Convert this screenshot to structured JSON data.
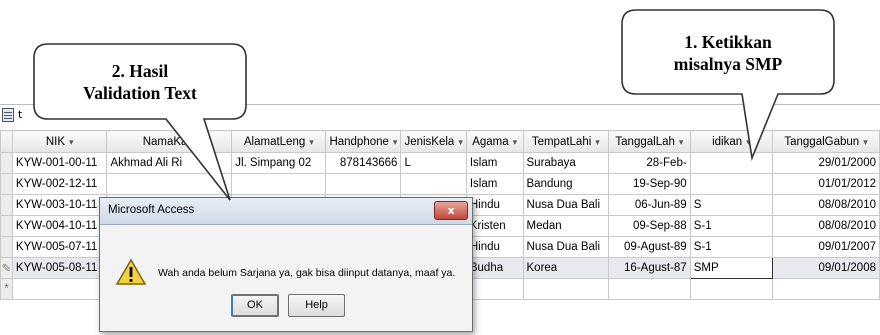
{
  "tab": {
    "label": "t"
  },
  "columns": [
    "NIK",
    "NamaKa",
    "AlamatLeng",
    "Handphone",
    "JenisKela",
    "Agama",
    "TempatLahi",
    "TanggalLah",
    "idikan",
    "TanggalGabun"
  ],
  "rows": [
    {
      "sel": "",
      "cells": [
        "KYW-001-00-11",
        "Akhmad Ali Ri",
        "Jl. Simpang 02",
        "878143666",
        "L",
        "Islam",
        "Surabaya",
        "28-Feb-",
        "",
        "29/01/2000"
      ]
    },
    {
      "sel": "",
      "cells": [
        "KYW-002-12-11",
        "",
        "",
        "",
        "",
        "Islam",
        "Bandung",
        "19-Sep-90",
        "",
        "01/01/2012"
      ]
    },
    {
      "sel": "",
      "cells": [
        "KYW-003-10-11",
        "",
        "",
        "",
        "",
        "Hindu",
        "Nusa Dua Bali",
        "06-Jun-89",
        "S",
        "08/08/2010"
      ]
    },
    {
      "sel": "",
      "cells": [
        "KYW-004-10-11",
        "",
        "",
        "",
        "",
        "Kristen",
        "Medan",
        "09-Sep-88",
        "S-1",
        "08/08/2010"
      ]
    },
    {
      "sel": "",
      "cells": [
        "KYW-005-07-11",
        "",
        "",
        "",
        "",
        "Hindu",
        "Nusa Dua Bali",
        "09-Agust-89",
        "S-1",
        "09/01/2007"
      ]
    },
    {
      "sel": "✎",
      "cells": [
        "KYW-005-08-11",
        "",
        "",
        "",
        "",
        "Budha",
        "Korea",
        "16-Agust-87",
        "SMP",
        "09/01/2008"
      ]
    },
    {
      "sel": "*",
      "cells": [
        "",
        "",
        "",
        "",
        "",
        "",
        "",
        "",
        "",
        ""
      ]
    }
  ],
  "dialog": {
    "title": "Microsoft Access",
    "close": "x",
    "message": "Wah anda belum Sarjana ya, gak bisa diinput datanya, maaf ya.",
    "ok": "OK",
    "help": "Help"
  },
  "callouts": {
    "left": {
      "line1": "2. Hasil",
      "line2": "Validation Text"
    },
    "right": {
      "line1": "1. Ketikkan",
      "line2": "misalnya SMP"
    }
  },
  "colors": {
    "warning": "#f4d03f",
    "callout_border": "#333333"
  }
}
